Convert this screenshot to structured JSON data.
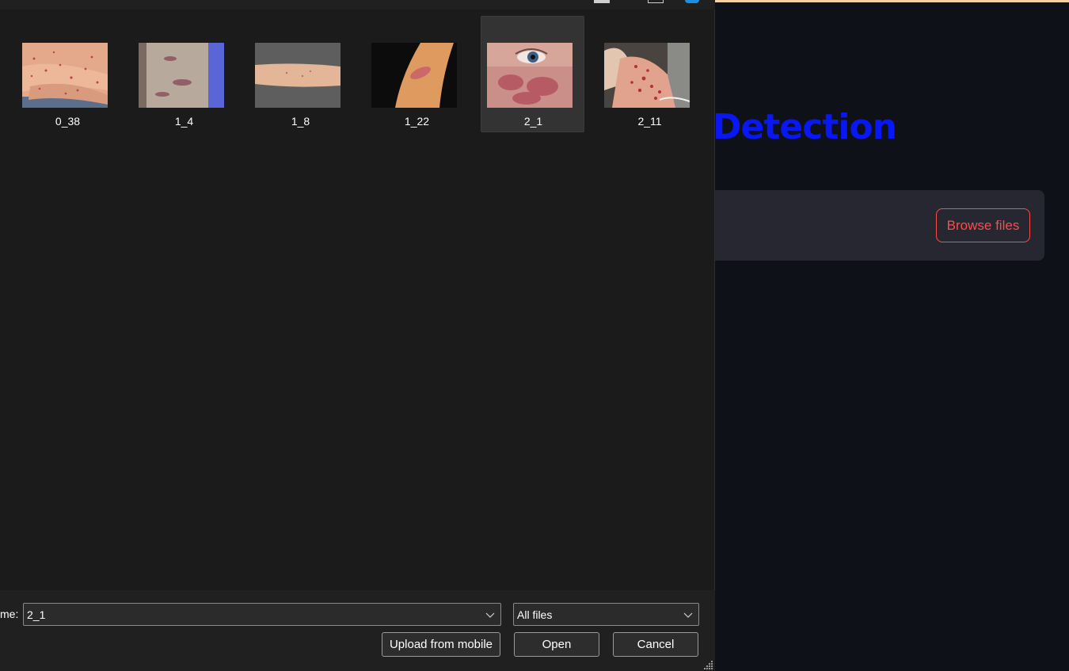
{
  "app": {
    "title_fragment": "Detection",
    "uploader": {
      "browse_label": "Browse files"
    },
    "colors": {
      "title": "#0a17f5",
      "accent": "#ff4b4b",
      "topbar": "#f3d1a0"
    }
  },
  "dialog": {
    "files": [
      {
        "label": "0_38",
        "selected": false
      },
      {
        "label": "1_4",
        "selected": false
      },
      {
        "label": "1_8",
        "selected": false
      },
      {
        "label": "1_22",
        "selected": false
      },
      {
        "label": "2_1",
        "selected": true
      },
      {
        "label": "2_11",
        "selected": false
      }
    ],
    "footer": {
      "filename_label": "me:",
      "filename_value": "2_1",
      "filetype_value": "All files",
      "upload_label": "Upload from mobile",
      "open_label": "Open",
      "cancel_label": "Cancel"
    },
    "icons": [
      "minimize-icon",
      "maximize-icon",
      "help-icon",
      "chevron-down-icon",
      "resize-grip-icon"
    ]
  }
}
